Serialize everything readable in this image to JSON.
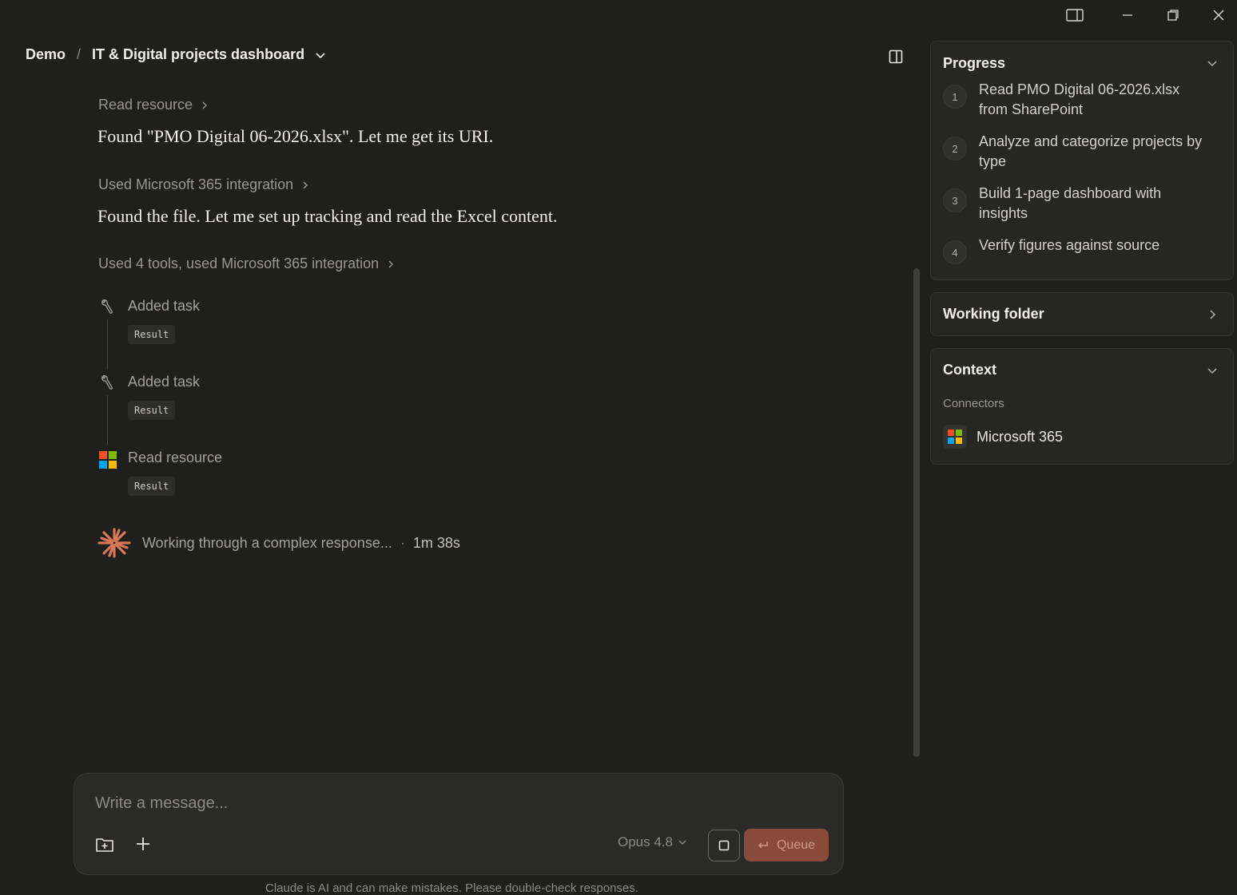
{
  "window": {
    "sidebar_toggle_icon": "sidebar-toggle-icon",
    "minimize_icon": "minimize-icon",
    "restore_icon": "restore-icon",
    "close_icon": "close-icon"
  },
  "header": {
    "breadcrumb_project": "Demo",
    "breadcrumb_separator": "/",
    "title": "IT & Digital projects dashboard",
    "title_menu_icon": "chevron-down-icon",
    "panel_toggle_icon": "panel-right-icon"
  },
  "chat": {
    "step1_tool": "Read resource",
    "step1_text": "Found \"PMO Digital 06-2026.xlsx\". Let me get its URI.",
    "step2_tool": "Used Microsoft 365 integration",
    "step2_text": "Found the file. Let me set up tracking and read the Excel content.",
    "step3_tool": "Used 4 tools, used Microsoft 365 integration",
    "tools": [
      {
        "label": "Added task",
        "result": "Result",
        "icon": "wrench-icon"
      },
      {
        "label": "Added task",
        "result": "Result",
        "icon": "wrench-icon"
      },
      {
        "label": "Read resource",
        "result": "Result",
        "icon": "microsoft-icon"
      }
    ],
    "status_text": "Working through a complex response...",
    "status_separator": "·",
    "status_time": "1m 38s",
    "status_icon": "claude-spark-icon"
  },
  "composer": {
    "placeholder": "Write a message...",
    "attach_folder_icon": "folder-plus-icon",
    "add_icon": "plus-icon",
    "model": "Opus 4.8",
    "stop_icon": "stop-icon",
    "queue_label": "Queue",
    "queue_icon": "enter-arrow-icon"
  },
  "disclaimer": "Claude is AI and can make mistakes. Please double-check responses.",
  "panel": {
    "progress": {
      "title": "Progress",
      "steps": [
        {
          "num": "1",
          "text": "Read PMO Digital 06-2026.xlsx from SharePoint"
        },
        {
          "num": "2",
          "text": "Analyze and categorize projects by type"
        },
        {
          "num": "3",
          "text": "Build 1-page dashboard with insights"
        },
        {
          "num": "4",
          "text": "Verify figures against source"
        }
      ]
    },
    "working_folder": {
      "title": "Working folder"
    },
    "context": {
      "title": "Context",
      "connectors_label": "Connectors",
      "connector_name": "Microsoft 365"
    }
  },
  "colors": {
    "background": "#1f1f1e",
    "accent": "#d97757",
    "queue_button": "#8a4a3a"
  }
}
